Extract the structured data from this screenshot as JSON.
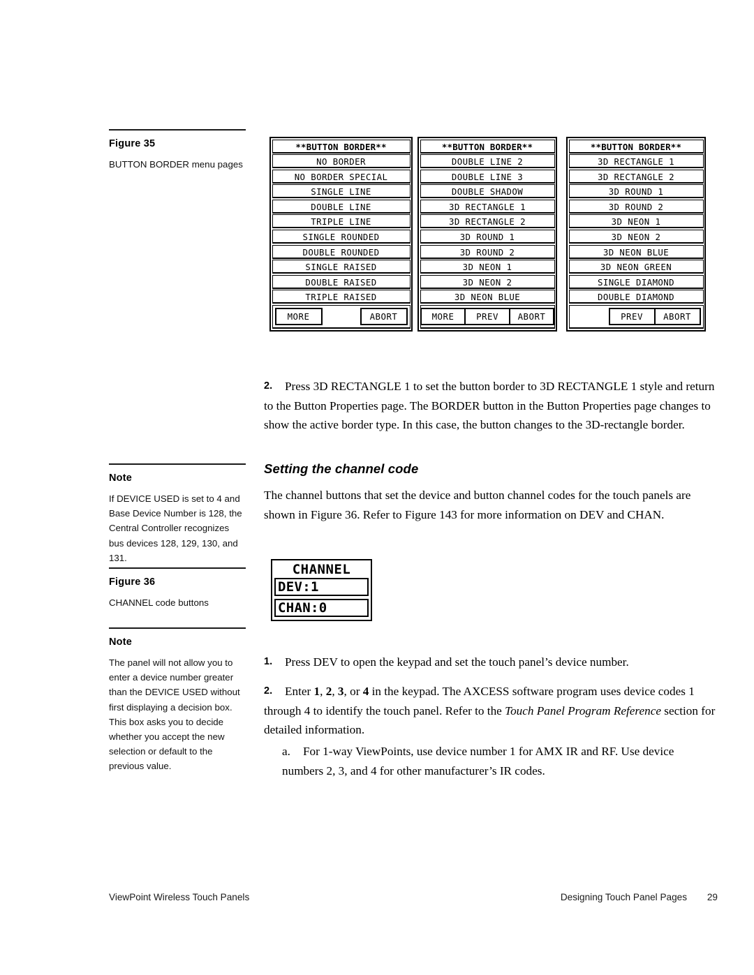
{
  "margin": {
    "figure35": {
      "heading": "Figure 35",
      "caption": "BUTTON BORDER menu pages"
    },
    "note1": {
      "heading": "Note",
      "body": "If DEVICE USED is set to 4 and Base Device Number is 128, the Central Controller recognizes bus devices 128, 129, 130, and 131."
    },
    "figure36": {
      "heading": "Figure 36",
      "caption": "CHANNEL code buttons"
    },
    "note2": {
      "heading": "Note",
      "body": "The panel will not allow you to enter a device number greater than the DEVICE USED without first displaying a decision box. This box asks you to decide whether you accept the new selection or default to the previous value."
    }
  },
  "figure35_panels": [
    {
      "title": "**BUTTON BORDER**",
      "items": [
        "NO BORDER",
        "NO BORDER SPECIAL",
        "SINGLE LINE",
        "DOUBLE LINE",
        "TRIPLE LINE",
        "SINGLE ROUNDED",
        "DOUBLE ROUNDED",
        "SINGLE RAISED",
        "DOUBLE RAISED",
        "TRIPLE RAISED"
      ],
      "buttons": [
        "MORE",
        "ABORT"
      ]
    },
    {
      "title": "**BUTTON BORDER**",
      "items": [
        "DOUBLE LINE 2",
        "DOUBLE LINE 3",
        "DOUBLE SHADOW",
        "3D RECTANGLE 1",
        "3D RECTANGLE 2",
        "3D ROUND 1",
        "3D ROUND 2",
        "3D NEON 1",
        "3D NEON 2",
        "3D NEON BLUE"
      ],
      "buttons": [
        "MORE",
        "PREV",
        "ABORT"
      ]
    },
    {
      "title": "**BUTTON BORDER**",
      "items": [
        "3D RECTANGLE 1",
        "3D RECTANGLE 2",
        "3D ROUND 1",
        "3D ROUND 2",
        "3D NEON 1",
        "3D NEON 2",
        "3D NEON BLUE",
        "3D NEON GREEN",
        "SINGLE DIAMOND",
        "DOUBLE DIAMOND"
      ],
      "buttons": [
        "PREV",
        "ABORT"
      ]
    }
  ],
  "figure36_channel": {
    "title": "CHANNEL",
    "dev_label": "DEV:1",
    "chan_label": "CHAN:0"
  },
  "content": {
    "step2_border": {
      "number": "2.",
      "text": "Press 3D RECTANGLE 1 to set the button border to 3D RECTANGLE 1 style and return to the Button Properties page. The BORDER button in the Button Properties page changes to show the active border type. In this case, the button changes to the 3D-rectangle border."
    },
    "section_heading": "Setting the channel code",
    "intro_paragraph": "The channel buttons that set the device and button channel codes for the touch panels are shown in Figure 36. Refer to Figure 143 for more information on DEV and CHAN.",
    "step1_channel": {
      "number": "1.",
      "text": "Press DEV to open the keypad and set the touch panel’s device number."
    },
    "step2_channel": {
      "number": "2.",
      "part1": "Enter ",
      "b1": "1",
      "sep1": ", ",
      "b2": "2",
      "sep2": ", ",
      "b3": "3",
      "sep3": ", or ",
      "b4": "4",
      "part2": " in the keypad. The AXCESS software program uses device codes 1 through 4 to identify the touch panel. Refer to the ",
      "italic": "Touch Panel Program Reference",
      "part3": " section for detailed information."
    },
    "substep_a": {
      "letter": "a.",
      "text": "For 1-way ViewPoints, use device number 1 for AMX IR and RF. Use device numbers 2, 3, and 4 for other manufacturer’s IR codes."
    }
  },
  "footer": {
    "left": "ViewPoint Wireless Touch Panels",
    "right": "Designing Touch Panel Pages",
    "page": "29"
  }
}
